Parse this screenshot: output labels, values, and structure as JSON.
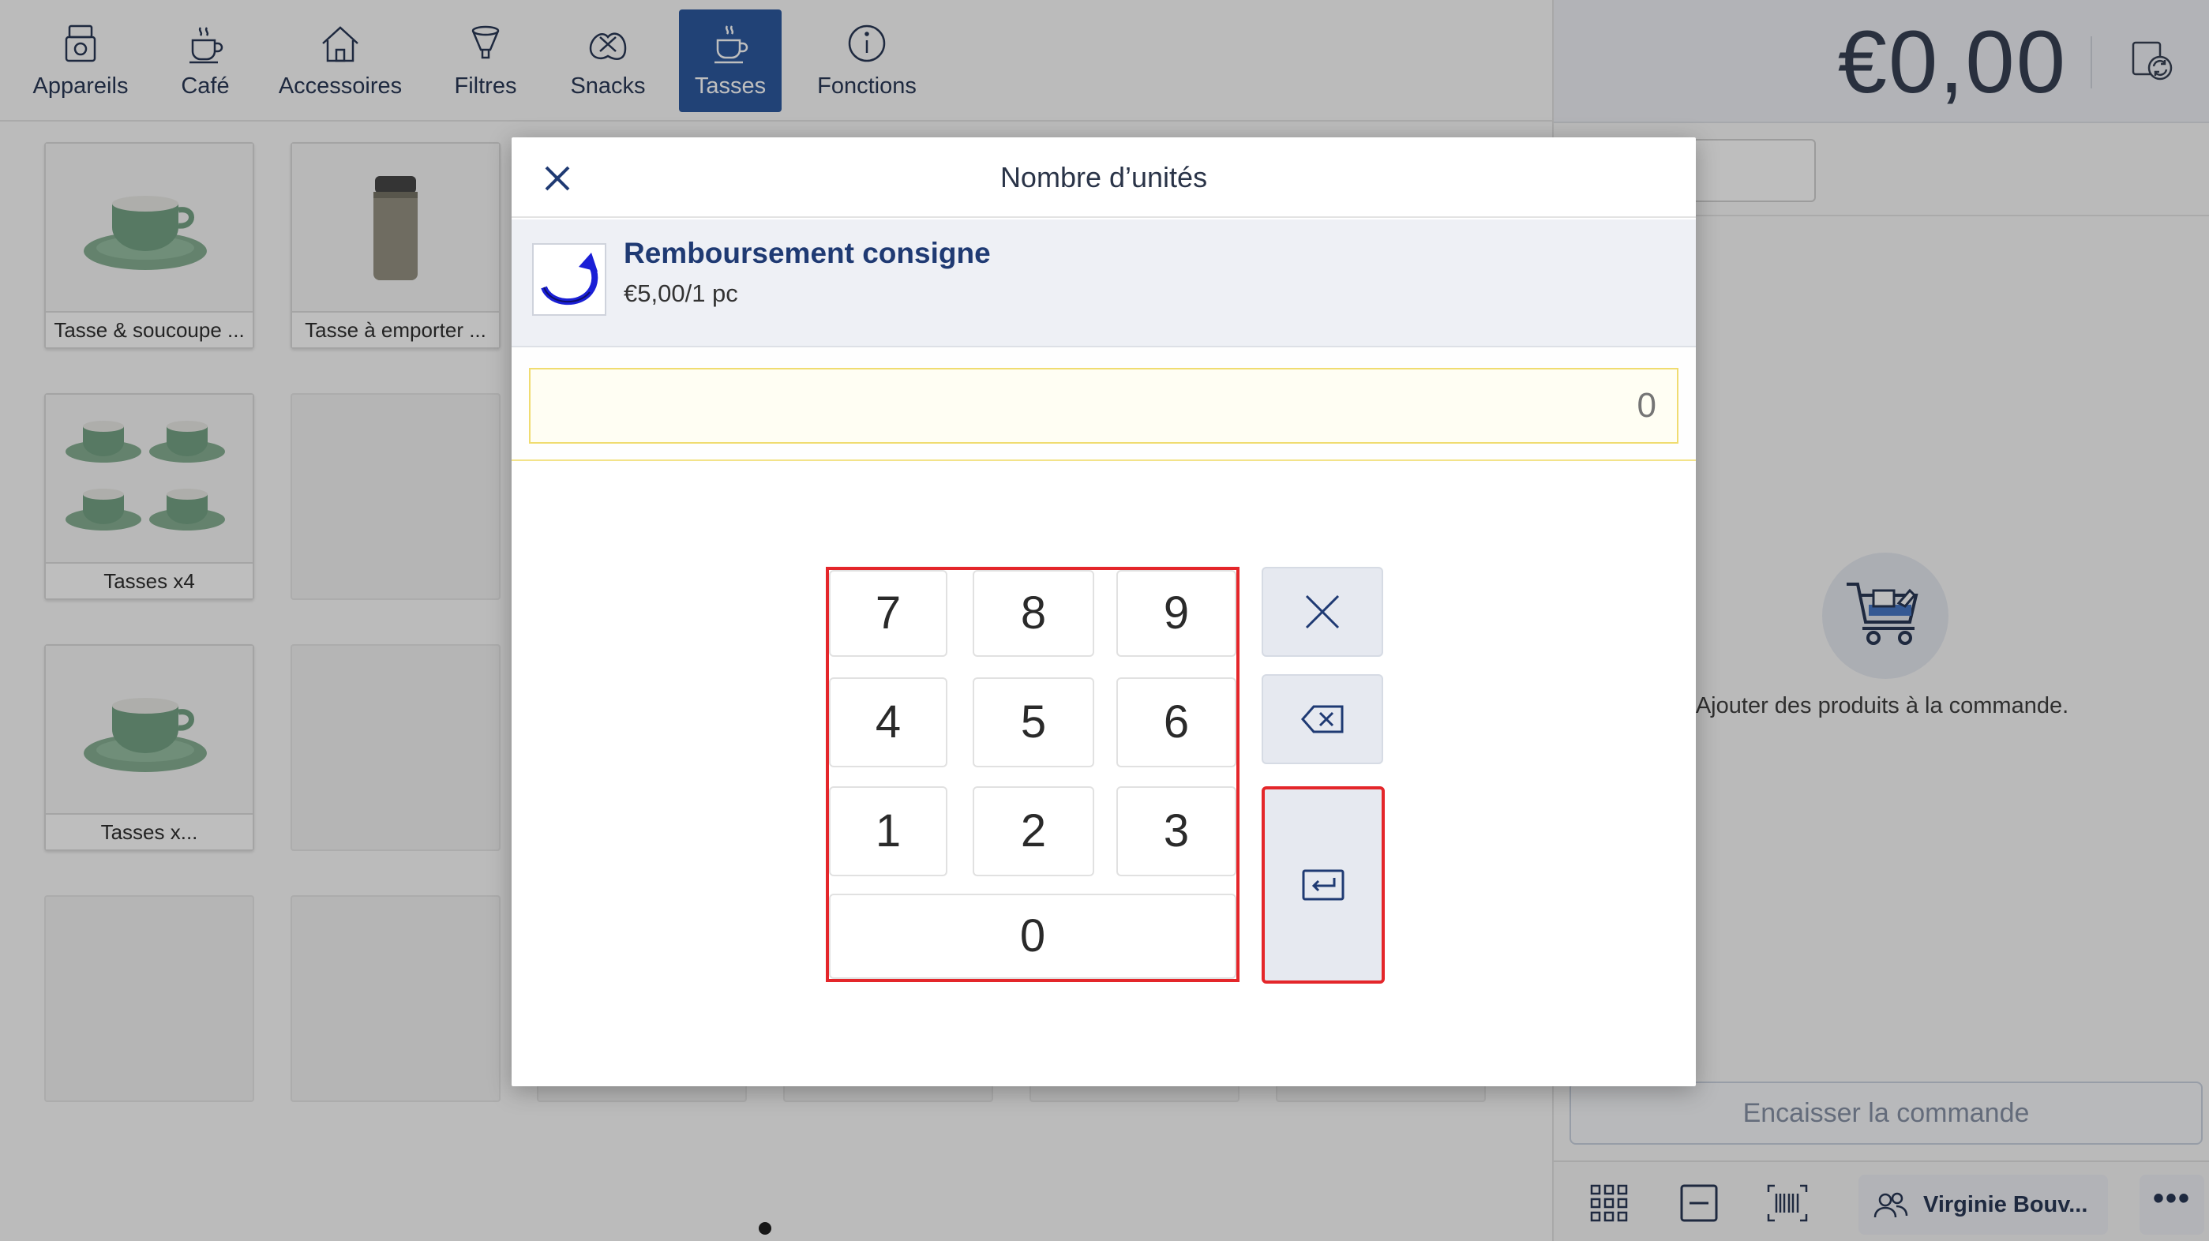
{
  "nav": {
    "categories": [
      {
        "label": "Appareils",
        "icon": "appliance-icon"
      },
      {
        "label": "Café",
        "icon": "coffee-icon"
      },
      {
        "label": "Accessoires",
        "icon": "home-icon"
      },
      {
        "label": "Filtres",
        "icon": "filter-icon"
      },
      {
        "label": "Snacks",
        "icon": "pretzel-icon"
      },
      {
        "label": "Tasses",
        "icon": "cup-icon",
        "active": true
      },
      {
        "label": "Fonctions",
        "icon": "info-icon"
      }
    ],
    "active_color": "#1f4e99"
  },
  "products": [
    {
      "label": "Tasse & soucoupe ..."
    },
    {
      "label": "Tasse à emporter ..."
    },
    {
      "label": "Tasses x4"
    },
    {
      "label": "Tasses x..."
    }
  ],
  "order": {
    "total": "€0,00",
    "empty_message": "Ajouter des produits à la commande.",
    "checkout_label": "Encaisser la commande",
    "user_name": "Virginie Bouv...",
    "more_label": "•••"
  },
  "modal": {
    "title": "Nombre d’unités",
    "product_name": "Remboursement consigne",
    "product_price": "€5,00/1 pc",
    "quantity_placeholder": "0",
    "keys": [
      "7",
      "8",
      "9",
      "4",
      "5",
      "6",
      "1",
      "2",
      "3",
      "0"
    ]
  },
  "colors": {
    "highlight": "#e4262a",
    "title_blue": "#1f3a73",
    "input_border": "#f0dc70"
  }
}
